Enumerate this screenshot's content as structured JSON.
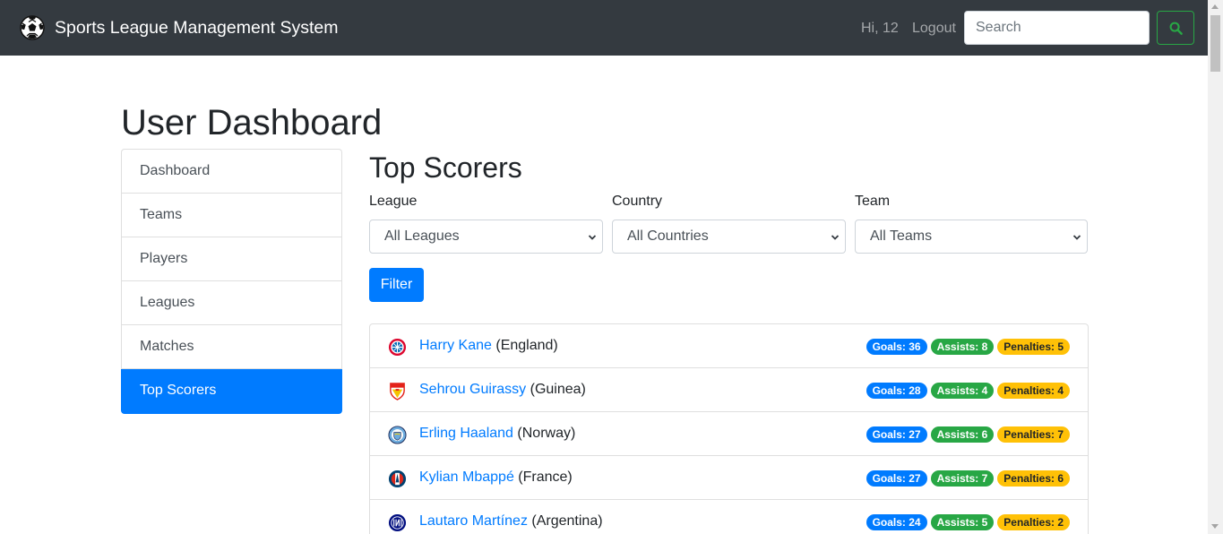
{
  "navbar": {
    "brand": "Sports League Management System",
    "greeting": "Hi, 12",
    "logout": "Logout",
    "search_placeholder": "Search",
    "search_icon": "search-icon",
    "search_button_color": "#28a745"
  },
  "page": {
    "title": "User Dashboard"
  },
  "sidebar": {
    "items": [
      {
        "label": "Dashboard",
        "active": false
      },
      {
        "label": "Teams",
        "active": false
      },
      {
        "label": "Players",
        "active": false
      },
      {
        "label": "Leagues",
        "active": false
      },
      {
        "label": "Matches",
        "active": false
      },
      {
        "label": "Top Scorers",
        "active": true
      }
    ],
    "active_color": "#007bff"
  },
  "main": {
    "title": "Top Scorers",
    "filters": [
      {
        "label": "League",
        "selected": "All Leagues"
      },
      {
        "label": "Country",
        "selected": "All Countries"
      },
      {
        "label": "Team",
        "selected": "All Teams"
      }
    ],
    "filter_button": "Filter",
    "scorers": [
      {
        "name": "Harry Kane",
        "country": "(England)",
        "club_icon": "bayern-munich-crest-icon",
        "goals": "Goals: 36",
        "assists": "Assists: 8",
        "penalties": "Penalties: 5"
      },
      {
        "name": "Sehrou Guirassy",
        "country": "(Guinea)",
        "club_icon": "vfb-stuttgart-crest-icon",
        "goals": "Goals: 28",
        "assists": "Assists: 4",
        "penalties": "Penalties: 4"
      },
      {
        "name": "Erling Haaland",
        "country": "(Norway)",
        "club_icon": "manchester-city-crest-icon",
        "goals": "Goals: 27",
        "assists": "Assists: 6",
        "penalties": "Penalties: 7"
      },
      {
        "name": "Kylian Mbappé",
        "country": "(France)",
        "club_icon": "psg-crest-icon",
        "goals": "Goals: 27",
        "assists": "Assists: 7",
        "penalties": "Penalties: 6"
      },
      {
        "name": "Lautaro Martínez",
        "country": "(Argentina)",
        "club_icon": "inter-milan-crest-icon",
        "goals": "Goals: 24",
        "assists": "Assists: 5",
        "penalties": "Penalties: 2"
      }
    ]
  },
  "colors": {
    "navbar_bg": "#343a40",
    "primary": "#007bff",
    "success": "#28a745",
    "warning": "#ffc107"
  }
}
